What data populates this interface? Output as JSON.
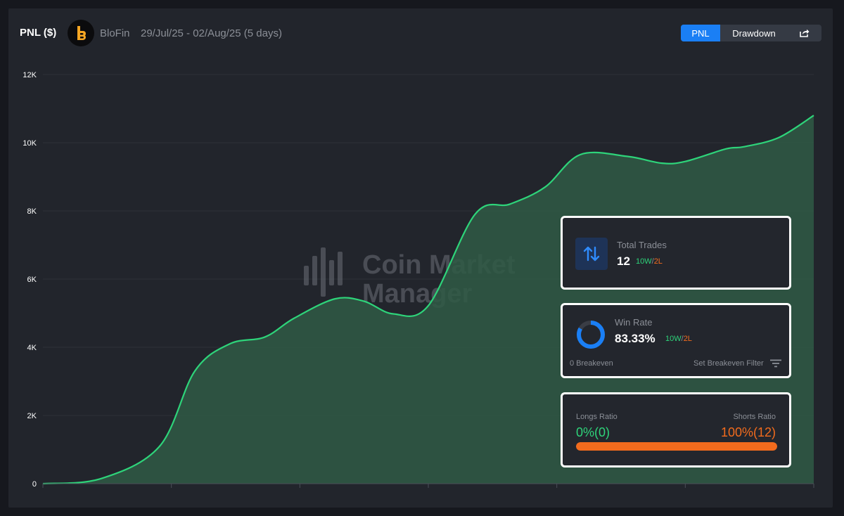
{
  "header": {
    "title": "PNL ($)",
    "exchange": "BloFin",
    "date_range": "29/Jul/25 - 02/Aug/25 (5 days)",
    "toggle": {
      "pnl_label": "PNL",
      "drawdown_label": "Drawdown",
      "active": "PNL"
    },
    "share_icon": "share-icon"
  },
  "watermark": {
    "line1": "Coin Market",
    "line2": "Manager"
  },
  "chart_data": {
    "type": "area",
    "title": "PNL ($)",
    "xlabel": "",
    "ylabel": "",
    "ylim": [
      0,
      12000
    ],
    "yticks": [
      "0",
      "2K",
      "4K",
      "6K",
      "8K",
      "10K",
      "12K"
    ],
    "grid": true,
    "color": "#2ed47a",
    "fill": "#2f5a45",
    "x": [
      0,
      0.5,
      1,
      1.3,
      1.6,
      1.9,
      2.15,
      2.5,
      2.75,
      3.0,
      3.3,
      3.7,
      4.0,
      4.3,
      4.6,
      5.0,
      5.3,
      5.5,
      5.85,
      6.0
    ],
    "series": [
      {
        "values": [
          0,
          150,
          1100,
          3300,
          4100,
          4300,
          4850,
          5420,
          5350,
          4980,
          5220,
          7900,
          8200,
          8700,
          9650,
          9600,
          9400,
          9450,
          9820,
          9880
        ]
      }
    ],
    "tail": {
      "x": [
        6.3,
        6.6
      ],
      "values": [
        10150,
        10800
      ]
    }
  },
  "cards": {
    "total_trades": {
      "label": "Total Trades",
      "value": "12",
      "wins": "10W",
      "slash": "/",
      "losses": "2L",
      "icon": "arrows-up-down-icon"
    },
    "win_rate": {
      "label": "Win Rate",
      "value": "83.33%",
      "wins": "10W",
      "slash": "/",
      "losses": "2L",
      "win_fraction": 0.8333,
      "breakeven": "0 Breakeven",
      "set_breakeven": "Set Breakeven Filter",
      "filter_icon": "filter-icon"
    },
    "ratio": {
      "longs_label": "Longs Ratio",
      "shorts_label": "Shorts Ratio",
      "longs_value": "0%(0)",
      "shorts_value": "100%(12)",
      "shorts_fraction": 1.0
    }
  }
}
